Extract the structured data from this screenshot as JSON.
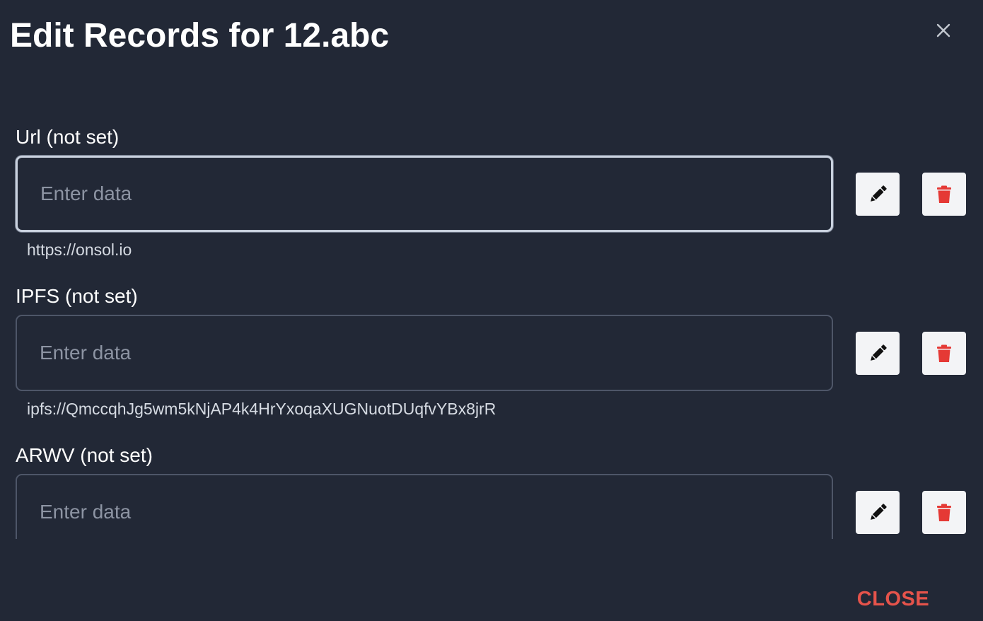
{
  "dialog": {
    "title": "Edit Records for 12.abc",
    "close_label": "CLOSE"
  },
  "colors": {
    "background": "#222836",
    "input_border": "#4e5668",
    "placeholder": "#8d94a3",
    "delete_icon": "#e53935",
    "close_text": "#e5534b"
  },
  "records": [
    {
      "label": "Url (not set)",
      "placeholder": "Enter data",
      "value": "https://onsol.io",
      "focused": true
    },
    {
      "label": "IPFS (not set)",
      "placeholder": "Enter data",
      "value": "ipfs://QmccqhJg5wm5kNjAP4k4HrYxoqaXUGNuotDUqfvYBx8jrR",
      "focused": false
    },
    {
      "label": "ARWV (not set)",
      "placeholder": "Enter data",
      "value": "",
      "focused": false
    }
  ],
  "icons": {
    "close": "close-icon",
    "edit": "pencil-icon",
    "delete": "trash-icon"
  }
}
